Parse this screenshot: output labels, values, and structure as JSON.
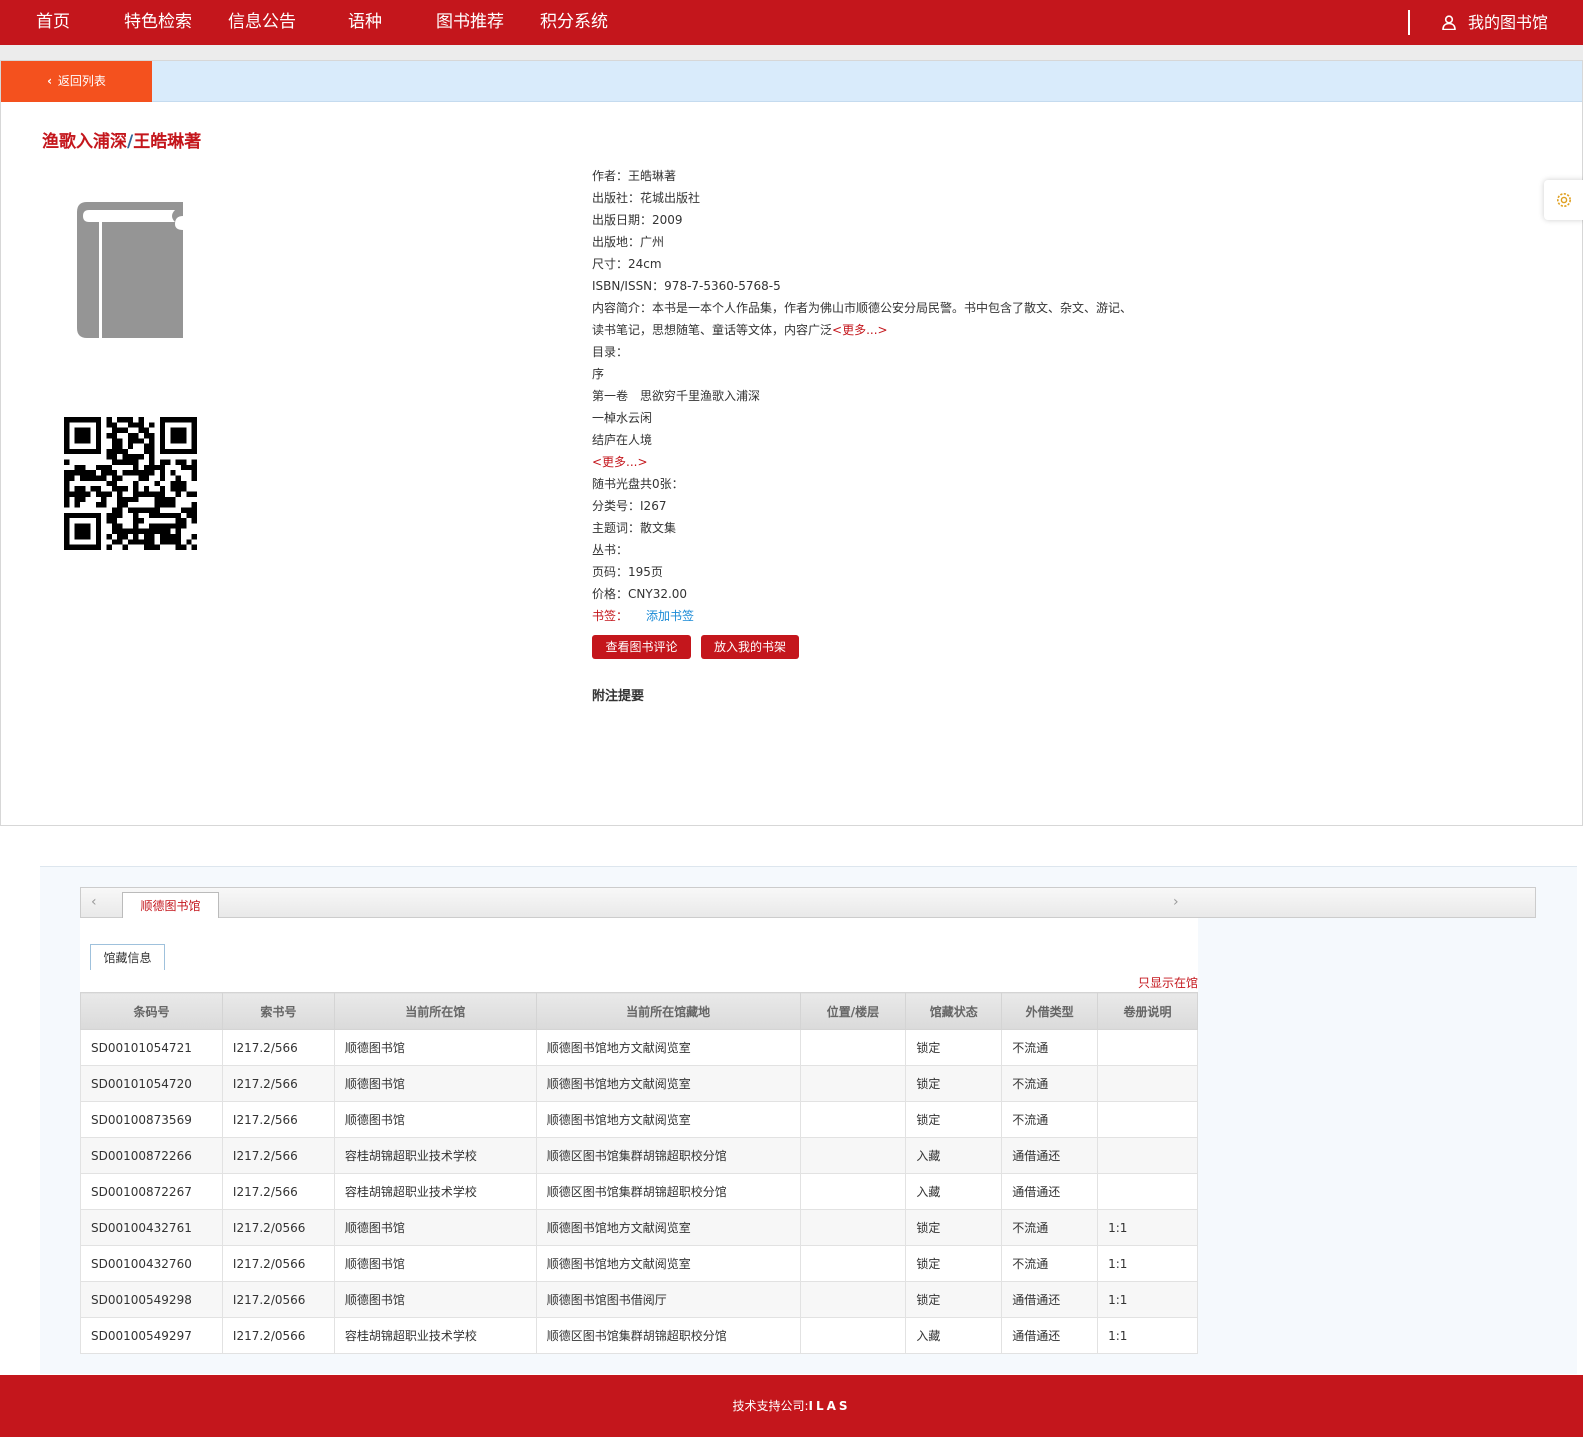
{
  "nav": {
    "items": [
      {
        "label": "首页"
      },
      {
        "label": "特色检索"
      },
      {
        "label": "信息公告"
      },
      {
        "label": "语种"
      },
      {
        "label": "图书推荐"
      },
      {
        "label": "积分系统"
      }
    ],
    "my_library": "我的图书馆"
  },
  "back_label": "返回列表",
  "book": {
    "title": "渔歌入浦深",
    "author_title": "王皓琳著",
    "fields": [
      {
        "label": "作者：",
        "value": "王皓琳著"
      },
      {
        "label": "出版社：",
        "value": "花城出版社"
      },
      {
        "label": "出版日期：",
        "value": "2009"
      },
      {
        "label": "出版地：",
        "value": "广州"
      },
      {
        "label": "尺寸：",
        "value": "24cm"
      },
      {
        "label": "ISBN/ISSN：",
        "value": "978-7-5360-5768-5"
      }
    ],
    "summary_label": "内容简介：",
    "summary_line1": "本书是一本个人作品集，作者为佛山市顺德公安分局民警。书中包含了散文、杂文、游记、",
    "summary_line2": "读书笔记，思想随笔、童话等文体，内容广泛",
    "more": "<更多...>",
    "toc_label": "目录：",
    "toc": [
      "序",
      "第一卷　思欲穷千里渔歌入浦深",
      "一棹水云闲",
      "结庐在人境"
    ],
    "toc_more": "<更多...>",
    "fields2": [
      {
        "label": "随书光盘共0张：",
        "value": ""
      },
      {
        "label": "分类号：",
        "value": "I267"
      },
      {
        "label": "主题词：",
        "value": "散文集"
      },
      {
        "label": "丛书：",
        "value": ""
      },
      {
        "label": "页码：",
        "value": "195页"
      },
      {
        "label": "价格：",
        "value": "CNY32.00"
      }
    ],
    "bookmark_label": "书签：",
    "bookmark_add": "添加书签",
    "btn_review": "查看图书评论",
    "btn_shelf": "放入我的书架",
    "annotation_title": "附注提要"
  },
  "holdings": {
    "library_tab": "顺德图书馆",
    "subtab": "馆藏信息",
    "only_in_library": "只显示在馆",
    "columns": [
      "条码号",
      "索书号",
      "当前所在馆",
      "当前所在馆藏地",
      "位置/楼层",
      "馆藏状态",
      "外借类型",
      "卷册说明"
    ],
    "rows": [
      [
        "SD00101054721",
        "I217.2/566",
        "顺德图书馆",
        "顺德图书馆地方文献阅览室",
        "",
        "锁定",
        "不流通",
        ""
      ],
      [
        "SD00101054720",
        "I217.2/566",
        "顺德图书馆",
        "顺德图书馆地方文献阅览室",
        "",
        "锁定",
        "不流通",
        ""
      ],
      [
        "SD00100873569",
        "I217.2/566",
        "顺德图书馆",
        "顺德图书馆地方文献阅览室",
        "",
        "锁定",
        "不流通",
        ""
      ],
      [
        "SD00100872266",
        "I217.2/566",
        "容桂胡锦超职业技术学校",
        "顺德区图书馆集群胡锦超职校分馆",
        "",
        "入藏",
        "通借通还",
        ""
      ],
      [
        "SD00100872267",
        "I217.2/566",
        "容桂胡锦超职业技术学校",
        "顺德区图书馆集群胡锦超职校分馆",
        "",
        "入藏",
        "通借通还",
        ""
      ],
      [
        "SD00100432761",
        "I217.2/0566",
        "顺德图书馆",
        "顺德图书馆地方文献阅览室",
        "",
        "锁定",
        "不流通",
        "1:1"
      ],
      [
        "SD00100432760",
        "I217.2/0566",
        "顺德图书馆",
        "顺德图书馆地方文献阅览室",
        "",
        "锁定",
        "不流通",
        "1:1"
      ],
      [
        "SD00100549298",
        "I217.2/0566",
        "顺德图书馆",
        "顺德图书馆图书借阅厅",
        "",
        "锁定",
        "通借通还",
        "1:1"
      ],
      [
        "SD00100549297",
        "I217.2/0566",
        "容桂胡锦超职业技术学校",
        "顺德区图书馆集群胡锦超职校分馆",
        "",
        "入藏",
        "通借通还",
        "1:1"
      ]
    ]
  },
  "footer": {
    "label": "技术支持公司:",
    "company": "ILAS"
  },
  "colors": {
    "brand_red": "#c4161c",
    "orange": "#f4511e",
    "light_blue": "#d9ebfb",
    "link_blue": "#1a8ad6"
  }
}
